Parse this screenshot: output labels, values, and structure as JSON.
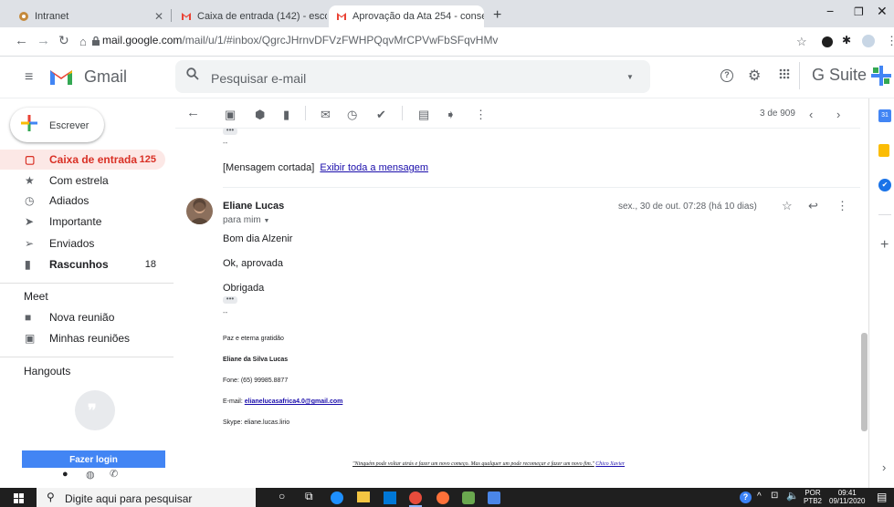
{
  "browser": {
    "tabs": [
      {
        "title": "Intranet",
        "active": false
      },
      {
        "title": "Caixa de entrada (142) - escolad",
        "active": false
      },
      {
        "title": "Aprovação da Ata 254 - conselh",
        "active": true
      }
    ],
    "url_host": "mail.google.com",
    "url_path": "/mail/u/1/#inbox/QgrcJHrnvDFVzFWHPQqvMrCPVwFbSFqvHMv"
  },
  "gmail": {
    "logo_text": "Gmail",
    "search_placeholder": "Pesquisar e-mail",
    "gsuite_text": "G Suite",
    "compose_label": "Escrever",
    "nav": [
      {
        "label": "Caixa de entrada",
        "count": "125",
        "icon": "inbox-icon",
        "active": true
      },
      {
        "label": "Com estrela",
        "count": "",
        "icon": "star-icon"
      },
      {
        "label": "Adiados",
        "count": "",
        "icon": "clock-icon"
      },
      {
        "label": "Importante",
        "count": "",
        "icon": "important-icon"
      },
      {
        "label": "Enviados",
        "count": "",
        "icon": "send-icon"
      },
      {
        "label": "Rascunhos",
        "count": "18",
        "icon": "draft-icon",
        "bold": true
      }
    ],
    "meet": {
      "title": "Meet",
      "new_meeting": "Nova reunião",
      "my_meetings": "Minhas reuniões"
    },
    "hangouts": {
      "title": "Hangouts",
      "login": "Fazer login"
    },
    "pager": "3 de 909"
  },
  "message": {
    "clipped": "[Mensagem cortada]",
    "show_full": "Exibir toda a mensagem",
    "sender": "Eliane Lucas",
    "to": "para mim",
    "date": "sex., 30 de out. 07:28 (há 10 dias)",
    "lines": [
      "Bom dia Alzenir",
      "Ok, aprovada",
      "Obrigada"
    ],
    "sig_dash": "--",
    "sig1": "Paz e eterna gratidão",
    "sig_name": "Eliane da Silva Lucas",
    "sig_phone": "Fone: (65) 99985.8877",
    "sig_email_label": "E-mail:",
    "sig_email": "elianelucasafrica4.0@gmail.com",
    "sig_skype": "Skype: eliane.lucas.lirio",
    "quote": "\"Ninguém pode voltar atrás e fazer um novo começo. Mas qualquer um pode recomeçar e fazer um novo fim.\"",
    "quote_author": "Chico Xavier"
  },
  "taskbar": {
    "search": "Digite aqui para pesquisar",
    "lang1": "POR",
    "lang2": "PTB2",
    "time": "09:41",
    "date": "09/11/2020"
  },
  "colors": {
    "accent": "#d93025",
    "link": "#1a0dab",
    "login": "#4285f4"
  }
}
